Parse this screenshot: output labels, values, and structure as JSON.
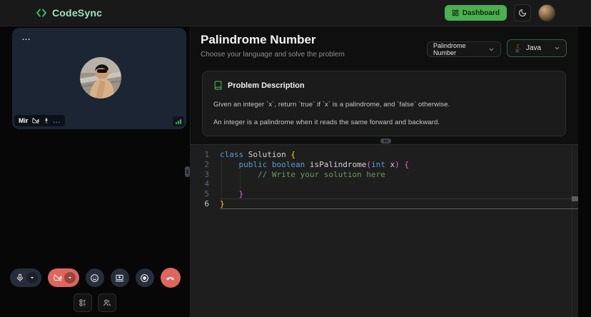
{
  "header": {
    "logo_text": "CodeSync",
    "dashboard_label": "Dashboard"
  },
  "video_panel": {
    "tile_menu_dots": "...",
    "participant_name": "Mir",
    "pill_more_dots": "..."
  },
  "main": {
    "title": "Palindrome Number",
    "subtitle": "Choose your language and solve the problem",
    "problem_select_value": "Palindrome Number",
    "language_select_value": "Java"
  },
  "problem": {
    "heading": "Problem Description",
    "paragraphs": [
      "Given an integer `x`, return `true` if `x` is a palindrome, and `false` otherwise.",
      "An integer is a palindrome when it reads the same forward and backward."
    ]
  },
  "colors": {
    "accent_green": "#4caf50",
    "danger_red": "#dd675c",
    "logo_green": "#2fd168",
    "signal_green": "#4caf50",
    "link_blue": "#4a90ff"
  },
  "icons": {
    "code-logo-icon": "angle brackets < >",
    "dashboard-icon": "layout grid",
    "moon-icon": "crescent moon",
    "camera-off-icon": "video camera with slash",
    "pin-icon": "push pin",
    "signal-strength-icon": "ascending bars",
    "mic-icon": "microphone",
    "chevron-down-icon": "chevron down",
    "emoji-icon": "smiley face",
    "screen-share-icon": "laptop with arrow",
    "record-icon": "concentric circles",
    "end-call-icon": "phone handset down",
    "whiteboard-icon": "board with blocks",
    "participants-icon": "two people",
    "book-icon": "book outline",
    "java-icon": "coffee cup"
  },
  "editor": {
    "language": "java",
    "active_line": 6,
    "colors": {
      "keyword": "#569cd6",
      "default": "#d4d4d4",
      "bracket1": "#ffd700",
      "bracket2": "#da70d6",
      "comment": "#6a9955"
    },
    "lines": [
      {
        "num": 1,
        "tokens": [
          {
            "text": "class",
            "color": "keyword"
          },
          {
            "text": " Solution ",
            "color": "default"
          },
          {
            "text": "{",
            "color": "bracket1"
          }
        ]
      },
      {
        "num": 2,
        "tokens": [
          {
            "text": "    ",
            "color": "default"
          },
          {
            "text": "public",
            "color": "keyword"
          },
          {
            "text": " ",
            "color": "default"
          },
          {
            "text": "boolean",
            "color": "keyword"
          },
          {
            "text": " isPalindrome",
            "color": "default"
          },
          {
            "text": "(",
            "color": "bracket2"
          },
          {
            "text": "int",
            "color": "keyword"
          },
          {
            "text": " x",
            "color": "default"
          },
          {
            "text": ")",
            "color": "bracket2"
          },
          {
            "text": " ",
            "color": "default"
          },
          {
            "text": "{",
            "color": "bracket2"
          }
        ]
      },
      {
        "num": 3,
        "tokens": [
          {
            "text": "        ",
            "color": "default"
          },
          {
            "text": "// Write your solution here",
            "color": "comment"
          }
        ]
      },
      {
        "num": 4,
        "tokens": []
      },
      {
        "num": 5,
        "tokens": [
          {
            "text": "    ",
            "color": "default"
          },
          {
            "text": "}",
            "color": "bracket2"
          }
        ]
      },
      {
        "num": 6,
        "tokens": [
          {
            "text": "}",
            "color": "bracket1"
          }
        ]
      }
    ]
  }
}
